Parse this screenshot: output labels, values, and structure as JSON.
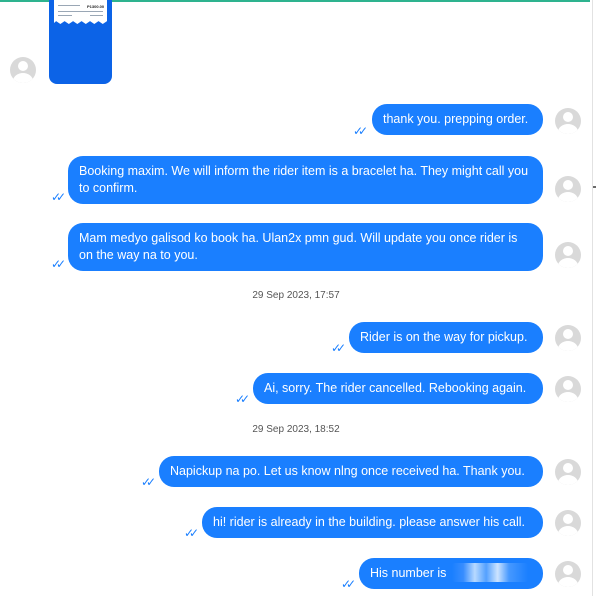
{
  "thumbnail": {
    "amount": "P1300.00"
  },
  "messages": [
    {
      "text": "thank you. prepping order."
    },
    {
      "text": "Booking maxim. We will inform the rider item is a bracelet ha. They might call you to confirm."
    },
    {
      "text": "Mam medyo galisod ko book ha. Ulan2x pmn gud. Will update you once rider is on the way na to you."
    },
    {
      "text": "Rider is on the way for pickup."
    },
    {
      "text": "Ai, sorry. The rider cancelled. Rebooking again."
    },
    {
      "text": "Napickup na po. Let us know nlng once received ha. Thank you."
    },
    {
      "text": "hi! rider is already in the building. please answer his call."
    },
    {
      "text": "His number is "
    }
  ],
  "dates": [
    "29 Sep 2023, 17:57",
    "29 Sep 2023, 18:52"
  ],
  "tick_glyph": "✓✓",
  "colors": {
    "bubble": "#1a7fff",
    "tick": "#1a7fff",
    "top_line": "#2eb38f"
  }
}
